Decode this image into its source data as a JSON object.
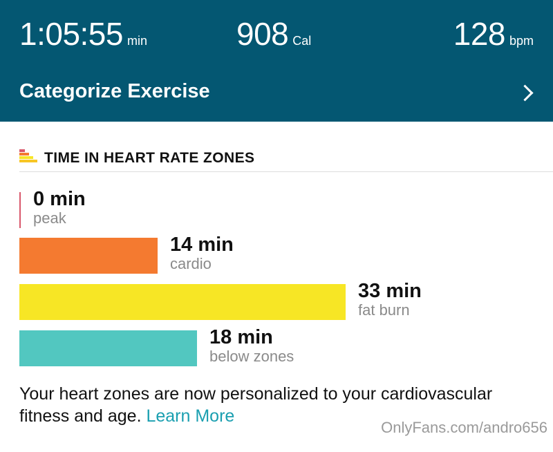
{
  "header": {
    "duration": {
      "value": "1:05:55",
      "unit": "min"
    },
    "calories": {
      "value": "908",
      "unit": "Cal"
    },
    "heart_rate": {
      "value": "128",
      "unit": "bpm"
    },
    "categorize_label": "Categorize Exercise"
  },
  "zones_section": {
    "title": "TIME IN HEART RATE ZONES",
    "scale_max_minutes": 33,
    "zones": [
      {
        "value": "0 min",
        "label": "peak",
        "minutes": 0,
        "color": "#d9576b"
      },
      {
        "value": "14 min",
        "label": "cardio",
        "minutes": 14,
        "color": "#f47a30"
      },
      {
        "value": "33 min",
        "label": "fat burn",
        "minutes": 33,
        "color": "#f7e625"
      },
      {
        "value": "18 min",
        "label": "below zones",
        "minutes": 18,
        "color": "#52c7c0"
      }
    ]
  },
  "note": {
    "text": "Your heart zones are now personalized to your cardiovascular fitness and age.",
    "link_label": "Learn More"
  },
  "watermark": "OnlyFans.com/andro656",
  "colors": {
    "header_bg": "#045772",
    "link": "#1a9fb0"
  }
}
